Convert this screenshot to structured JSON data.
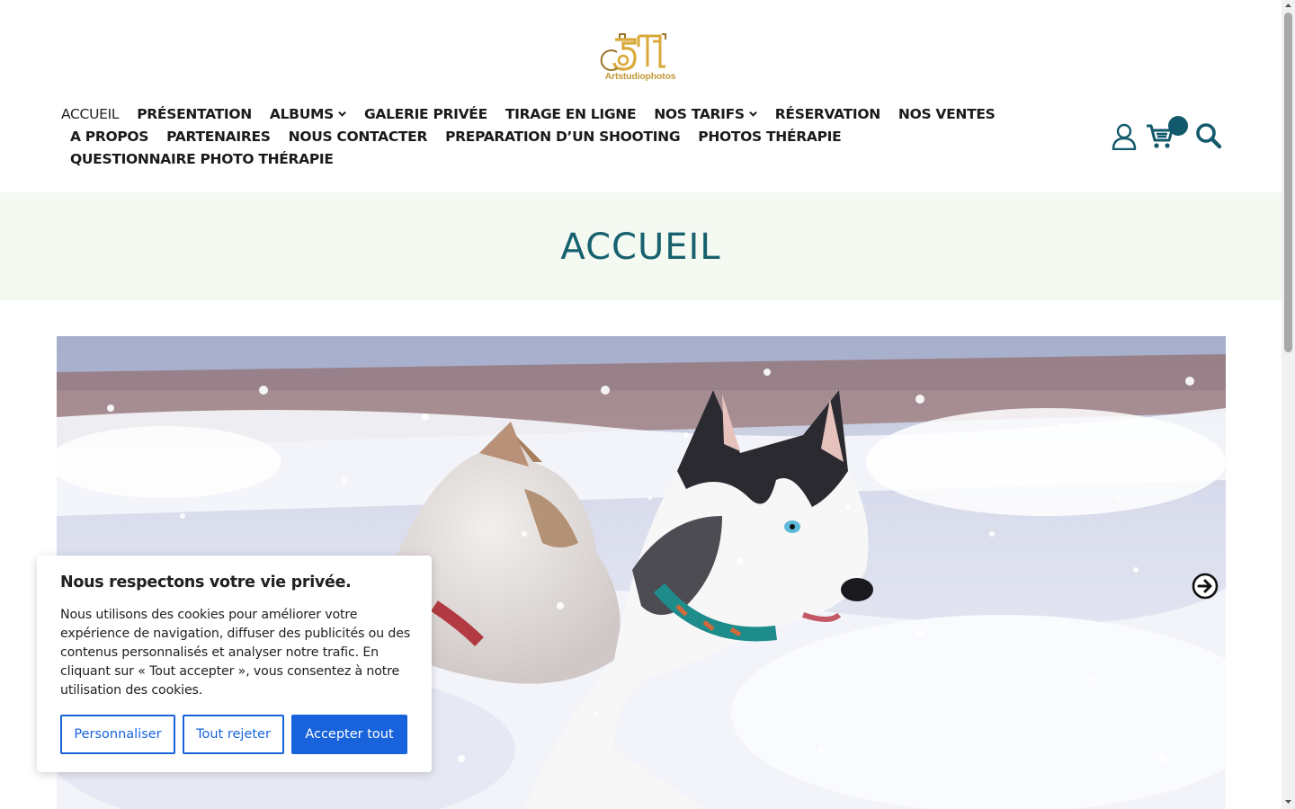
{
  "brand": {
    "logo_text": "Artstudiophotos",
    "logo_color": "#c19a3b"
  },
  "nav": {
    "row1": [
      {
        "label": "ACCUEIL",
        "active": true
      },
      {
        "label": "PRÉSENTATION"
      },
      {
        "label": "ALBUMS",
        "dropdown": true
      },
      {
        "label": "GALERIE PRIVÉE"
      },
      {
        "label": "TIRAGE EN LIGNE"
      },
      {
        "label": "NOS TARIFS",
        "dropdown": true
      },
      {
        "label": "RÉSERVATION"
      },
      {
        "label": "NOS VENTES"
      }
    ],
    "row2": [
      {
        "label": "A PROPOS"
      },
      {
        "label": "PARTENAIRES"
      },
      {
        "label": "NOUS CONTACTER"
      },
      {
        "label": "PREPARATION D’UN SHOOTING"
      },
      {
        "label": "PHOTOS THÉRAPIE"
      }
    ],
    "row3": [
      {
        "label": "QUESTIONNAIRE PHOTO THÉRAPIE"
      }
    ]
  },
  "header_icons": [
    "user-icon",
    "cart-icon",
    "search-icon"
  ],
  "page": {
    "title": "ACCUEIL"
  },
  "colors": {
    "accent": "#12596b",
    "title": "#17616e",
    "band": "#f4f9f2",
    "cookie_button": "#1863dc"
  },
  "cookie": {
    "title": "Nous respectons votre vie privée.",
    "text": "Nous utilisons des cookies pour améliorer votre expérience de navigation, diffuser des publicités ou des contenus personnalisés et analyser notre trafic. En cliquant sur « Tout accepter », vous consentez à notre utilisation des cookies.",
    "buttons": {
      "customize": "Personnaliser",
      "reject": "Tout rejeter",
      "accept": "Accepter tout"
    }
  }
}
